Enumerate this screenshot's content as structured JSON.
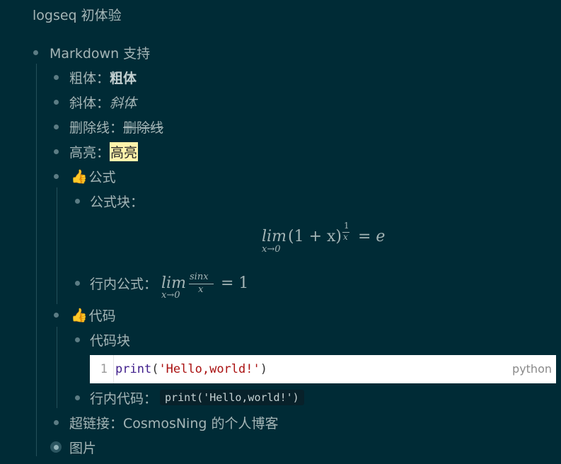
{
  "page": {
    "title": "logseq 初体验"
  },
  "blocks": {
    "markdown": {
      "label": "Markdown 支持"
    },
    "bold": {
      "prefix": "粗体：",
      "value": "粗体"
    },
    "italic": {
      "prefix": "斜体：",
      "value": "斜体"
    },
    "strike": {
      "prefix": "删除线：",
      "value": "删除线"
    },
    "highlight": {
      "prefix": "高亮：",
      "value": "高亮"
    },
    "formula": {
      "emoji": "👍",
      "label": "公式",
      "block_label": "公式块：",
      "block_formula": {
        "lim": "lim",
        "sub": "x→0",
        "body": "(1 + x)",
        "exp_num": "1",
        "exp_den": "x",
        "rhs": "= e"
      },
      "inline_prefix": "行内公式：",
      "inline_formula": {
        "lim": "lim",
        "sub": "x→0",
        "num": "sinx",
        "den": "x",
        "rhs": "= 1"
      }
    },
    "code": {
      "emoji": "👍",
      "label": "代码",
      "block_label": "代码块",
      "block": {
        "line_number": "1",
        "keyword": "print",
        "open": "(",
        "string": "'Hello,world!'",
        "close": ")",
        "language": "python"
      },
      "inline_prefix": "行内代码：",
      "inline_code": "print('Hello,world!')"
    },
    "link": {
      "prefix": "超链接：",
      "text": "CosmosNing 的个人博客"
    },
    "image": {
      "label": "图片"
    }
  }
}
